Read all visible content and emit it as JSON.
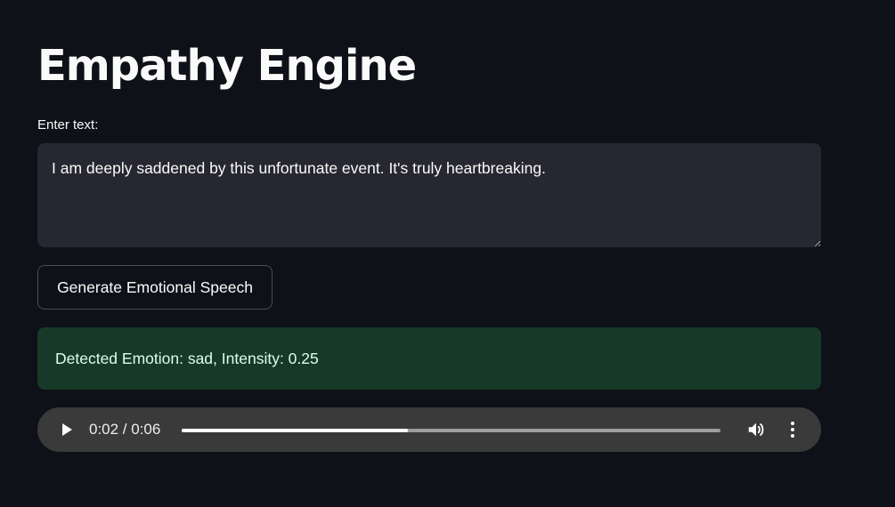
{
  "app": {
    "title": "Empathy Engine"
  },
  "input": {
    "label": "Enter text:",
    "value": "I am deeply saddened by this unfortunate event. It's truly heartbreaking."
  },
  "actions": {
    "generate_label": "Generate Emotional Speech"
  },
  "result": {
    "message": "Detected Emotion: sad, Intensity: 0.25",
    "color": "#173928"
  },
  "audio": {
    "time_display": "0:02 / 0:06",
    "progress_fraction": 0.42,
    "play_icon": "play-icon",
    "volume_icon": "volume-icon",
    "menu_icon": "more-vertical-icon"
  },
  "colors": {
    "background": "#0e1117",
    "input_background": "#262730",
    "player_background": "#3a3a3a"
  }
}
